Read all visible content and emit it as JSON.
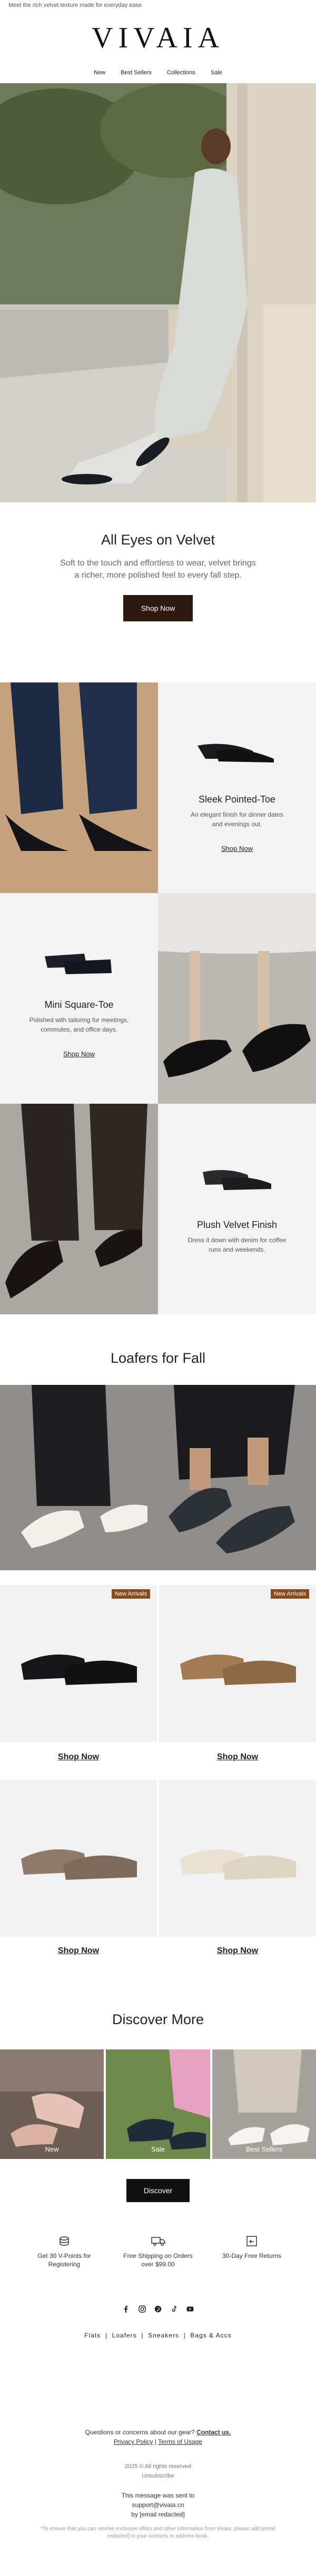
{
  "preheader": "Meet the rich velvet texture made for everyday ease",
  "brand": "VIVAIA",
  "nav": [
    "New",
    "Best Sellers",
    "Collections",
    "Sale"
  ],
  "hero_section": {
    "title": "All Eyes on Velvet",
    "body": "Soft to the touch and effortless to wear, velvet brings a richer, more polished feel to every fall step.",
    "button": "Shop Now"
  },
  "tiles": [
    {
      "title": "Sleek Pointed-Toe",
      "desc": "An elegant finish for dinner dates and evenings out.",
      "link": "Shop Now"
    },
    {
      "title": "Mini Square-Toe",
      "desc": "Polished with tailoring for meetings, commutes, and office days.",
      "link": "Shop Now"
    },
    {
      "title": "Plush Velvet Finish",
      "desc": "Dress it down with denim for coffee runs and weekends.",
      "link": "Shop Now"
    }
  ],
  "loafers": {
    "title": "Loafers for Fall",
    "badge": "New Arrivals",
    "products": [
      "Shop Now",
      "Shop Now",
      "Shop Now",
      "Shop Now"
    ]
  },
  "discover": {
    "title": "Discover More",
    "captions": [
      "New",
      "Sale",
      "Best Sellers"
    ],
    "button": "Discover"
  },
  "perks": [
    {
      "icon": "coins-icon",
      "text": "Get 30 V-Points for Registering"
    },
    {
      "icon": "truck-icon",
      "text": "Free Shipping on Orders over $99.00"
    },
    {
      "icon": "return-box-icon",
      "text": "30-Day Free Returns"
    }
  ],
  "social": [
    "facebook-icon",
    "instagram-icon",
    "pinterest-icon",
    "tiktok-icon",
    "youtube-icon"
  ],
  "categories": [
    "Flats",
    "Loafers",
    "Sneakers",
    "Bags & Accs"
  ],
  "footer": {
    "questions": "Questions or concerns about our gear?",
    "contact": "Contact us.",
    "privacy": "Privacy Policy",
    "sep": "|",
    "terms": "Terms of Usage",
    "copyright": "2025 © All rights reserved",
    "unsubscribe": "Unsubscribe",
    "sent_to": "This message was sent to",
    "email": "support@vivaia.cn",
    "by": "by [email redacted]",
    "disclaimer": "*To ensure that you can receive exclusive offers and other information from Vivaia, please add [email redacted] to your contacts or address book."
  },
  "colors": {
    "brown_button": "#2e1a10",
    "badge": "#8a4a1c",
    "tile_bg": "#f3f3f3"
  }
}
